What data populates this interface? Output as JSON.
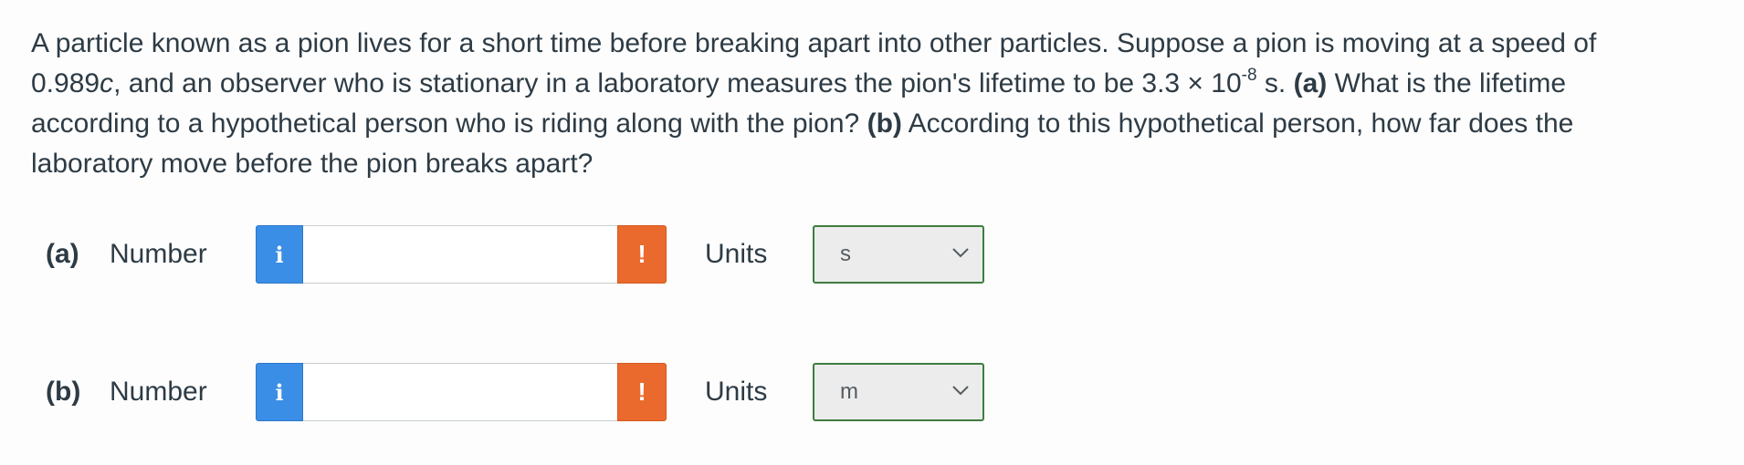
{
  "question": {
    "text_1": "A particle known as a pion lives for a short time before breaking apart into other particles. Suppose a pion is moving at a speed of 0.989",
    "c_symbol": "c",
    "text_2": ", and an observer who is stationary in a laboratory measures the pion's lifetime to be 3.3 × 10",
    "exponent": "-8",
    "text_3": " s. ",
    "part_a_marker": "(a)",
    "text_4": " What is the lifetime according to a hypothetical person who is riding along with the pion? ",
    "part_b_marker": "(b)",
    "text_5": " According to this hypothetical person, how far does the laboratory move before the pion breaks apart?"
  },
  "answers": [
    {
      "part_label": "(a)",
      "number_label": "Number",
      "info_icon": "info-icon",
      "info_glyph": "i",
      "value": "",
      "warning_icon": "warning-icon",
      "warning_glyph": "!",
      "units_label": "Units",
      "unit_selected": "s"
    },
    {
      "part_label": "(b)",
      "number_label": "Number",
      "info_icon": "info-icon",
      "info_glyph": "i",
      "value": "",
      "warning_icon": "warning-icon",
      "warning_glyph": "!",
      "units_label": "Units",
      "unit_selected": "m"
    }
  ],
  "colors": {
    "info": "#3a8ee6",
    "warning": "#ea6a2d",
    "select_border": "#3e7d3e",
    "text": "#2d3b45"
  }
}
